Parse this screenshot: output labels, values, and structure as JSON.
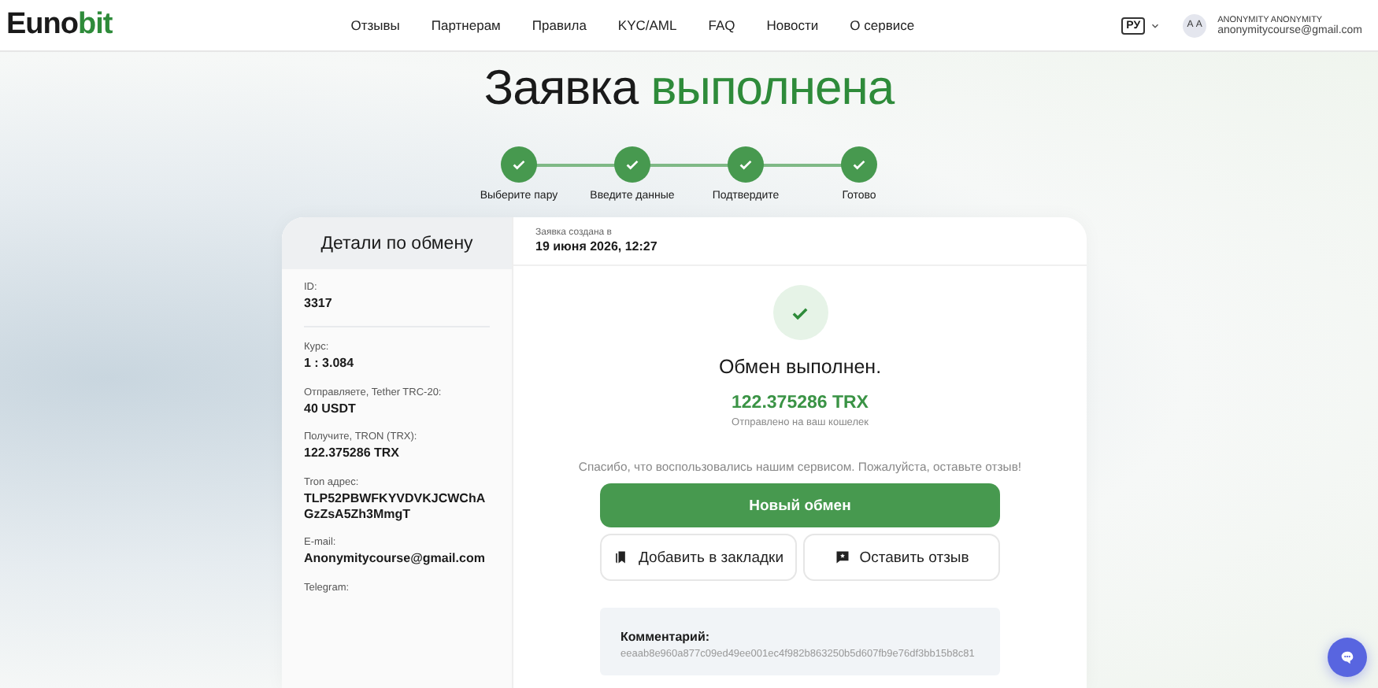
{
  "header": {
    "logo": {
      "prefix": "Euno",
      "accent": "bit"
    },
    "nav": [
      {
        "label": "Отзывы"
      },
      {
        "label": "Партнерам"
      },
      {
        "label": "Правила"
      },
      {
        "label": "KYC/AML"
      },
      {
        "label": "FAQ"
      },
      {
        "label": "Новости"
      },
      {
        "label": "О сервисе"
      }
    ],
    "language": "РУ",
    "user": {
      "initials": "А А",
      "name": "ANONYMITY ANONYMITY",
      "email": "anonymitycourse@gmail.com"
    }
  },
  "title": {
    "text": "Заявка",
    "accent": "выполнена"
  },
  "steps": [
    {
      "label": "Выберите пару",
      "done": true
    },
    {
      "label": "Введите данные",
      "done": true
    },
    {
      "label": "Подтвердите",
      "done": true
    },
    {
      "label": "Готово",
      "done": true
    }
  ],
  "details": {
    "heading": "Детали по обмену",
    "fields": [
      {
        "kind": "text",
        "label": "ID:",
        "value": "3317"
      },
      {
        "kind": "text",
        "label": "Курс:",
        "value": "1 : 3.084"
      },
      {
        "kind": "send",
        "label": "Отправляете, Tether TRC-20:",
        "value": "40 USDT"
      },
      {
        "kind": "receive",
        "label": "Получите, TRON (TRX):",
        "value": "122.375286 TRX"
      },
      {
        "kind": "text",
        "label": "Tron адрес:",
        "value": "TLP52PBWFKYVDVKJCWChAGzZsA5Zh3MmgT"
      },
      {
        "kind": "text",
        "label": "E-mail:",
        "value": "Anonymitycourse@gmail.com"
      },
      {
        "kind": "text",
        "label": "Telegram:"
      }
    ]
  },
  "order": {
    "created_label": "Заявка создана в",
    "created_at": "19 июня 2026, 12:27",
    "status": "Обмен выполнен.",
    "amount": "122.375286 TRX",
    "amount_note": "Отправлено на ваш кошелек",
    "thanks": "Спасибо, что воспользовались нашим сервисом. Пожалуйста, оставьте отзыв!",
    "buttons": [
      {
        "kind": "primary",
        "label": "Новый обмен"
      },
      {
        "kind": "bookmark",
        "label": "Добавить в закладки"
      },
      {
        "kind": "review",
        "label": "Оставить отзыв"
      }
    ],
    "comment": {
      "label": "Комментарий:",
      "value": "eeaab8e960a877c09ed49ee001ec4f982b863250b5d607fb9e76df3bb15b8c81"
    }
  }
}
